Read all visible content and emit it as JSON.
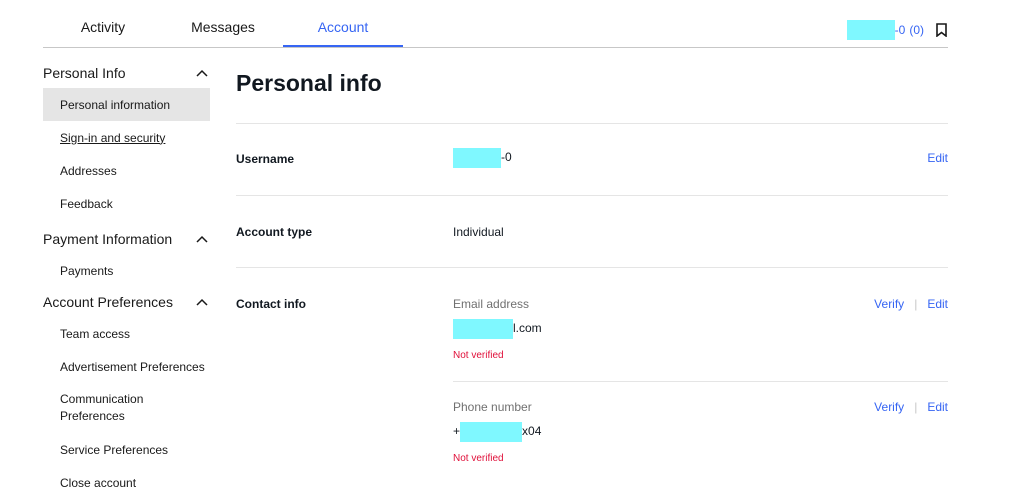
{
  "tabs": [
    {
      "label": "Activity"
    },
    {
      "label": "Messages"
    },
    {
      "label": "Account"
    }
  ],
  "header": {
    "user_suffix": "-0",
    "notification_count": "(0)",
    "bookmark_icon": "bookmark-icon"
  },
  "sidebar": {
    "sections": [
      {
        "title": "Personal Info",
        "items": [
          "Personal information",
          "Sign-in and security",
          "Addresses",
          "Feedback"
        ]
      },
      {
        "title": "Payment Information",
        "items": [
          "Payments"
        ]
      },
      {
        "title": "Account Preferences",
        "items": [
          "Team access",
          "Advertisement Preferences",
          "Communication Preferences",
          "Service Preferences",
          "Close account"
        ]
      }
    ]
  },
  "main": {
    "title": "Personal info",
    "username": {
      "label": "Username",
      "value_suffix": "-0",
      "edit": "Edit"
    },
    "account_type": {
      "label": "Account type",
      "value": "Individual"
    },
    "contact": {
      "label": "Contact info",
      "email": {
        "label": "Email address",
        "value_suffix": "l.com",
        "status": "Not verified",
        "verify": "Verify",
        "edit": "Edit"
      },
      "phone": {
        "label": "Phone number",
        "value_prefix": "+",
        "value_suffix": "x04",
        "status": "Not verified",
        "verify": "Verify",
        "edit": "Edit"
      }
    }
  },
  "colors": {
    "accent": "#3665f3",
    "error": "#e0103a",
    "redaction": "#7ff8ff"
  }
}
